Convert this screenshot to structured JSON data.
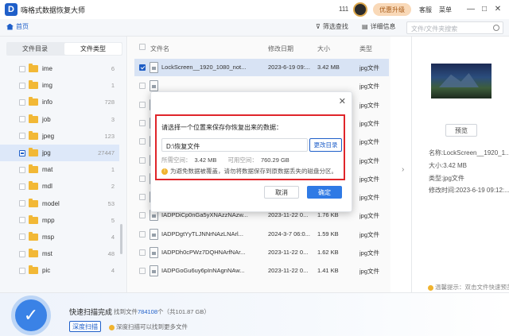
{
  "app": {
    "title": "嗨格式数据恢复大师",
    "logo_letter": "D",
    "count": "111",
    "upgrade": "优惠升级",
    "service": "客服",
    "menu": "菜单",
    "win_min": "—",
    "win_max": "□",
    "win_close": "✕"
  },
  "toolbar": {
    "home": "首页",
    "filter": "筛选查找",
    "details": "详细信息",
    "search_placeholder": "文件/文件夹搜索"
  },
  "sidebar": {
    "tabs": [
      "文件目录",
      "文件类型"
    ],
    "folders": [
      {
        "name": "ime",
        "count": "6"
      },
      {
        "name": "img",
        "count": "1"
      },
      {
        "name": "info",
        "count": "728"
      },
      {
        "name": "job",
        "count": "3"
      },
      {
        "name": "jpeg",
        "count": "123"
      },
      {
        "name": "jpg",
        "count": "27447"
      },
      {
        "name": "mat",
        "count": "1"
      },
      {
        "name": "mdl",
        "count": "2"
      },
      {
        "name": "model",
        "count": "53"
      },
      {
        "name": "mpp",
        "count": "5"
      },
      {
        "name": "msp",
        "count": "4"
      },
      {
        "name": "mst",
        "count": "48"
      },
      {
        "name": "pic",
        "count": "4"
      }
    ]
  },
  "filelist": {
    "headers": {
      "name": "文件名",
      "date": "修改日期",
      "size": "大小",
      "type": "类型"
    },
    "rows": [
      {
        "name": "LockScreen__1920_1080_not...",
        "date": "2023-6-19 09:...",
        "size": "3.42 MB",
        "type": "jpg文件",
        "checked": true
      },
      {
        "name": "",
        "date": "",
        "size": "",
        "type": "jpg文件",
        "checked": false
      },
      {
        "name": "",
        "date": "",
        "size": "",
        "type": "jpg文件",
        "checked": false
      },
      {
        "name": "",
        "date": "",
        "size": "",
        "type": "jpg文件",
        "checked": false
      },
      {
        "name": "",
        "date": "",
        "size": "",
        "type": "jpg文件",
        "checked": false
      },
      {
        "name": "",
        "date": "",
        "size": "",
        "type": "jpg文件",
        "checked": false
      },
      {
        "name": "",
        "date": "",
        "size": "",
        "type": "jpg文件",
        "checked": false
      },
      {
        "name": "",
        "date": "",
        "size": "",
        "type": "jpg文件",
        "checked": false
      },
      {
        "name": "IADPDiCp0nGa5yXNAzzNAzw...",
        "date": "2023-11-22 0...",
        "size": "1.76 KB",
        "type": "jpg文件",
        "checked": false
      },
      {
        "name": "IADPDgtYyTLJNNrNAzLNArl...",
        "date": "2024-3-7 06:0...",
        "size": "1.59 KB",
        "type": "jpg文件",
        "checked": false
      },
      {
        "name": "IADPDh0cPWz7DQHNArfNAr...",
        "date": "2023-11-22 0...",
        "size": "1.62 KB",
        "type": "jpg文件",
        "checked": false
      },
      {
        "name": "IADPGoGu6uy6pInNAgnNAw...",
        "date": "2023-11-22 0...",
        "size": "1.41 KB",
        "type": "jpg文件",
        "checked": false
      }
    ]
  },
  "preview": {
    "button": "预览",
    "name": "名称:LockScreen__1920_1...",
    "size": "大小:3.42 MB",
    "type": "类型:jpg文件",
    "modified": "修改时间:2023-6-19 09:12:...",
    "tip": "温馨提示：双击文件快速预览"
  },
  "scan": {
    "title": "快速扫描完成",
    "found_prefix": "找到文件",
    "found_count": "784108",
    "found_suffix": "个（共101.87 GB）",
    "deep_button": "深度扫描",
    "deep_tip": "深度扫描可以找到更多文件"
  },
  "dialog": {
    "close": "✕",
    "prompt": "请选择一个位置来保存你恢复出来的数据：",
    "path": "D:\\恢复文件",
    "change_dir": "更改目录",
    "required_label": "所需空间：",
    "required_value": "3.42 MB",
    "available_label": "可用空间：",
    "available_value": "760.29 GB",
    "warning": "为避免数据被覆盖，请勿将数据保存到原数据丢失的磁盘分区。",
    "cancel": "取消",
    "ok": "确定"
  },
  "colors": {
    "accent": "#1f5fc9",
    "highlight_border": "#e0252a",
    "ok_button": "#2f7ae5"
  }
}
